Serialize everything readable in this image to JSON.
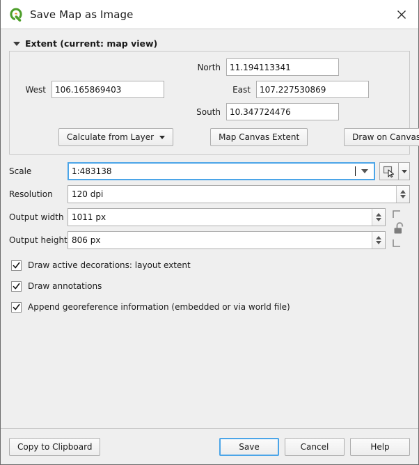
{
  "window": {
    "title": "Save Map as Image",
    "logo_icon": "qgis-logo-icon",
    "close_icon": "close-icon"
  },
  "extent_group": {
    "title": "Extent (current: map view)",
    "collapse_icon": "chevron-down-icon",
    "fields": {
      "north_label": "North",
      "north_value": "11.194113341",
      "west_label": "West",
      "west_value": "106.165869403",
      "east_label": "East",
      "east_value": "107.227530869",
      "south_label": "South",
      "south_value": "10.347724476"
    },
    "buttons": {
      "calculate_from_layer": "Calculate from Layer",
      "calculate_from_layer_icon": "chevron-down-icon",
      "map_canvas_extent": "Map Canvas Extent",
      "draw_on_canvas": "Draw on Canvas"
    }
  },
  "form": {
    "scale_label": "Scale",
    "scale_value": "1:483138",
    "scale_dropdown_icon": "chevron-down-icon",
    "scale_tool_icon": "select-extent-cursor-icon",
    "scale_tool_dropdown_icon": "chevron-down-icon",
    "resolution_label": "Resolution",
    "resolution_value": "120 dpi",
    "output_width_label": "Output width",
    "output_width_value": "1011 px",
    "output_height_label": "Output height",
    "output_height_value": "806 px",
    "lock_aspect_icon": "unlocked-padlock-icon"
  },
  "options": [
    {
      "label": "Draw active decorations: layout extent",
      "checked": true
    },
    {
      "label": "Draw annotations",
      "checked": true
    },
    {
      "label": "Append georeference information (embedded or via world file)",
      "checked": true
    }
  ],
  "footer": {
    "copy_to_clipboard": "Copy to Clipboard",
    "save": "Save",
    "cancel": "Cancel",
    "help": "Help"
  },
  "colors": {
    "dialog_bg": "#efefef",
    "titlebar_bg": "#ffffff",
    "focus_blue": "#4ba5e8",
    "field_bg": "#ffffff",
    "border": "#adadad",
    "qgis_green": "#4d9e2a",
    "qgis_orange": "#e88b20"
  }
}
